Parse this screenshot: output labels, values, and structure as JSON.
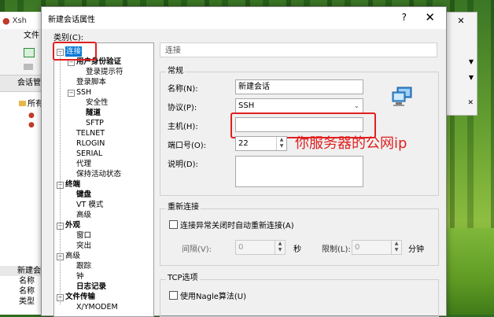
{
  "background_app": {
    "title": "Xsh",
    "menu_file": "文件(F)",
    "sessions_header": "会话管理器",
    "tree_root": "所有",
    "props_rows": [
      "新建会话",
      "名称",
      "名称",
      "类型"
    ]
  },
  "dialog": {
    "title": "新建会话属性",
    "help": "?",
    "close": "✕",
    "category_label": "类别(C):",
    "tree": [
      {
        "label": "连接",
        "level": 0,
        "expander": "−",
        "selected": true,
        "bold": false
      },
      {
        "label": "用户身份验证",
        "level": 1,
        "expander": "−",
        "bold": true
      },
      {
        "label": "登录提示符",
        "level": 2,
        "bold": false
      },
      {
        "label": "登录脚本",
        "level": 1,
        "bold": false
      },
      {
        "label": "SSH",
        "level": 1,
        "expander": "−",
        "bold": false
      },
      {
        "label": "安全性",
        "level": 2,
        "bold": false
      },
      {
        "label": "隧道",
        "level": 2,
        "bold": true
      },
      {
        "label": "SFTP",
        "level": 2,
        "bold": false
      },
      {
        "label": "TELNET",
        "level": 1,
        "bold": false
      },
      {
        "label": "RLOGIN",
        "level": 1,
        "bold": false
      },
      {
        "label": "SERIAL",
        "level": 1,
        "bold": false
      },
      {
        "label": "代理",
        "level": 1,
        "bold": false
      },
      {
        "label": "保持活动状态",
        "level": 1,
        "bold": false
      },
      {
        "label": "终端",
        "level": 0,
        "expander": "−",
        "bold": true
      },
      {
        "label": "键盘",
        "level": 1,
        "bold": true
      },
      {
        "label": "VT 模式",
        "level": 1,
        "bold": false
      },
      {
        "label": "高级",
        "level": 1,
        "bold": false
      },
      {
        "label": "外观",
        "level": 0,
        "expander": "−",
        "bold": true
      },
      {
        "label": "窗口",
        "level": 1,
        "bold": false
      },
      {
        "label": "突出",
        "level": 1,
        "bold": false
      },
      {
        "label": "高级",
        "level": 0,
        "expander": "−",
        "bold": false
      },
      {
        "label": "跟踪",
        "level": 1,
        "bold": false
      },
      {
        "label": "钟",
        "level": 1,
        "bold": false
      },
      {
        "label": "日志记录",
        "level": 1,
        "bold": true
      },
      {
        "label": "文件传输",
        "level": 0,
        "expander": "−",
        "bold": true
      },
      {
        "label": "X/YMODEM",
        "level": 1,
        "bold": false
      }
    ],
    "section_title": "连接",
    "general": {
      "group_label": "常规",
      "name_label": "名称(N):",
      "name_value": "新建会话",
      "protocol_label": "协议(P):",
      "protocol_value": "SSH",
      "host_label": "主机(H):",
      "host_value": "",
      "port_label": "端口号(O):",
      "port_value": "22",
      "desc_label": "说明(D):",
      "desc_value": ""
    },
    "reconnect": {
      "group_label": "重新连接",
      "checkbox_label": "连接异常关闭时自动重新连接(A)",
      "checked": false,
      "interval_label": "间隔(V):",
      "interval_value": "0",
      "seconds_unit": "秒",
      "limit_label": "限制(L):",
      "limit_value": "0",
      "minutes_unit": "分钟"
    },
    "tcp": {
      "group_label": "TCP选项",
      "nagle_label": "使用Nagle算法(U)",
      "checked": false
    }
  },
  "annotation": {
    "text": "你服务器的公网ip",
    "color": "#e02020"
  },
  "colors": {
    "selection": "#0078d7",
    "highlight_box": "#e02020"
  }
}
